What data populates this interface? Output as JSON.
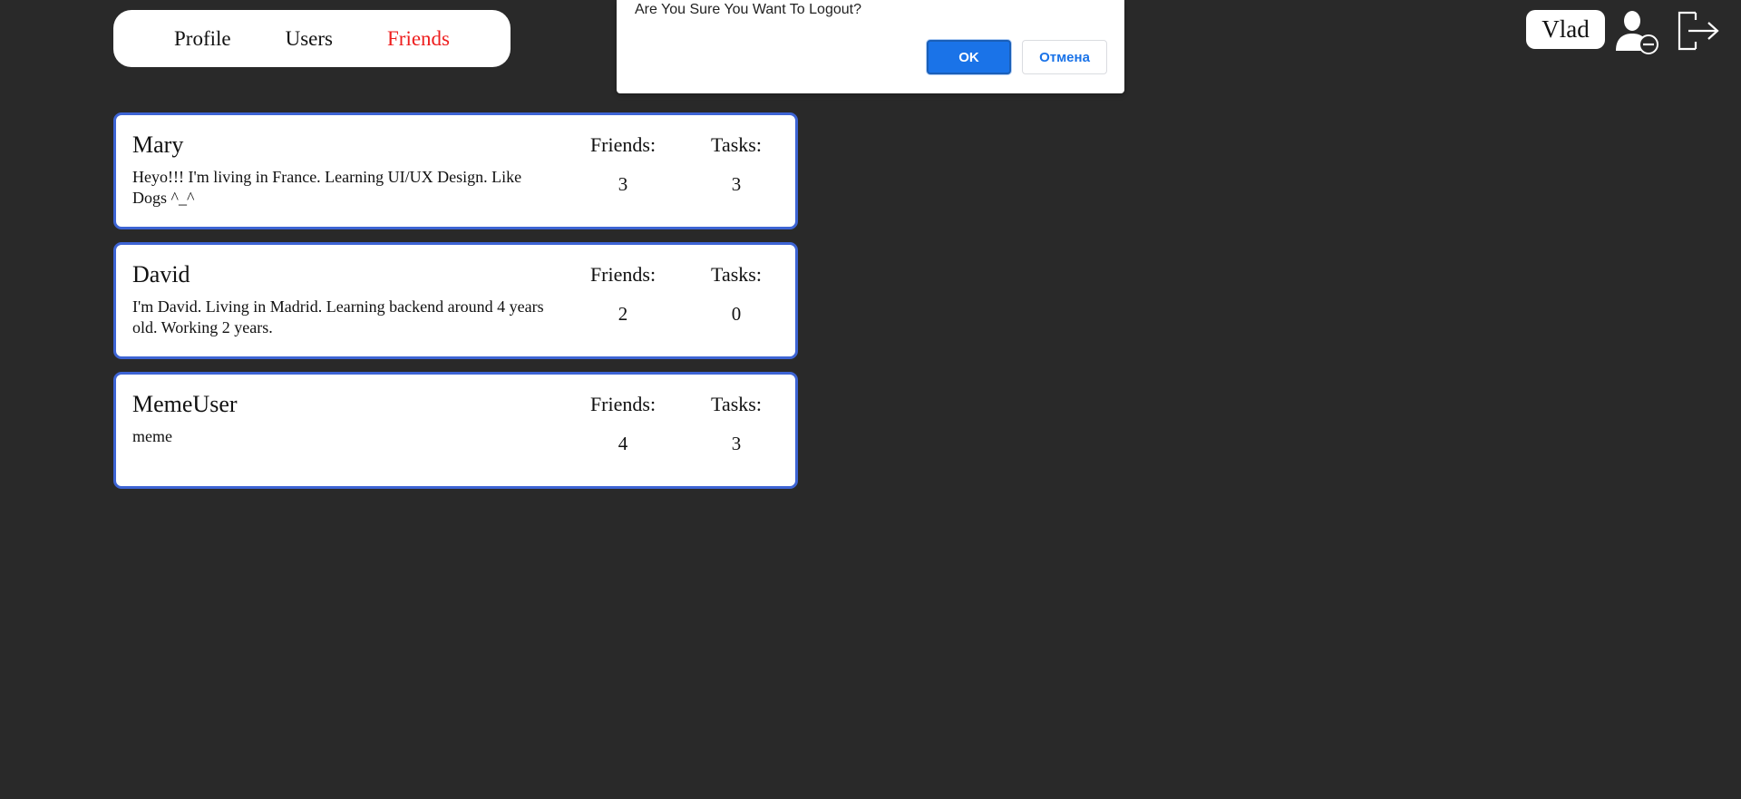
{
  "nav": {
    "items": [
      {
        "label": "Profile",
        "active": false
      },
      {
        "label": "Users",
        "active": false
      },
      {
        "label": "Friends",
        "active": true
      }
    ]
  },
  "header": {
    "username": "Vlad",
    "remove_user_icon": "user-minus-icon",
    "logout_icon": "logout-icon"
  },
  "dialog": {
    "message": "Are You Sure You Want To Logout?",
    "ok_label": "OK",
    "cancel_label": "Отмена"
  },
  "friends": [
    {
      "name": "Mary",
      "bio": "Heyo!!! I'm living in France. Learning UI/UX Design. Like Dogs ^_^",
      "friends_label": "Friends:",
      "friends_count": "3",
      "tasks_label": "Tasks:",
      "tasks_count": "3"
    },
    {
      "name": "David",
      "bio": "I'm David. Living in Madrid. Learning backend around 4 years old. Working 2 years.",
      "friends_label": "Friends:",
      "friends_count": "2",
      "tasks_label": "Tasks:",
      "tasks_count": "0"
    },
    {
      "name": "MemeUser",
      "bio": "meme",
      "friends_label": "Friends:",
      "friends_count": "4",
      "tasks_label": "Tasks:",
      "tasks_count": "3"
    }
  ],
  "colors": {
    "background": "#292929",
    "active_nav": "#ee1d1d",
    "card_border": "#3d64d4",
    "ok_button": "#1a73e8"
  }
}
